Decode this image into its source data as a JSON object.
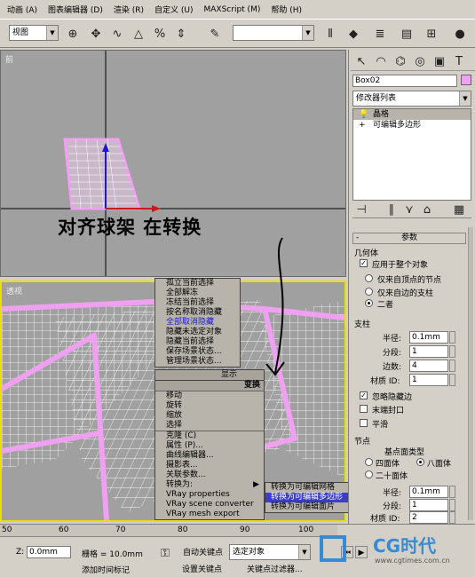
{
  "menu": [
    "动画 (A)",
    "图表编辑器 (D)",
    "渲染 (R)",
    "自定义 (U)",
    "MAXScript (M)",
    "帮助 (H)"
  ],
  "toolbar": {
    "view_combo": "视图",
    "selection_set_combo": "",
    "select_combo": "选择"
  },
  "viewports": {
    "top_label": "前",
    "perspective_label": "透视"
  },
  "annotation": "对齐球架  在转换",
  "context_menu_left": {
    "top_items": [
      "孤立当前选择",
      "全部解冻",
      "冻结当前选择",
      "按名称取消隐藏",
      "全部取消隐藏",
      "隐藏未选定对象",
      "隐藏当前选择",
      "保存场景状态...",
      "管理场景状态..."
    ],
    "display_header": "显示",
    "transform_header": "变换",
    "transform_items": [
      "移动",
      "旋转",
      "缩放",
      "选择",
      "克隆 (C)",
      "属性 (P)...",
      "曲线编辑器...",
      "摄影表...",
      "关联参数...",
      "转换为:",
      "VRay properties",
      "VRay scene converter",
      "VRay mesh export"
    ]
  },
  "submenu": [
    "转换为可编辑网格",
    "转换为可编辑多边形",
    "转换为可编辑面片"
  ],
  "command_panel": {
    "object_name": "Box02",
    "modifier_list": "修改器列表",
    "stack": [
      "晶格",
      "可编辑多边形"
    ],
    "rollout_title": "参数",
    "geometry_group": "几何体",
    "apply_whole": "应用于整个对象",
    "radio_vertex_only": "仅来自顶点的节点",
    "radio_edge_only": "仅来自边的支柱",
    "radio_both": "二者",
    "struts_group": "支柱",
    "radius_label": "半径:",
    "radius_value": "0.1mm",
    "segments_label": "分段:",
    "segments_value": "1",
    "sides_label": "边数:",
    "sides_value": "4",
    "material_label": "材质 ID:",
    "material_value": "1",
    "ignore_hidden": "忽略隐藏边",
    "end_caps": "末端封口",
    "smooth1": "平滑",
    "joints_group": "节点",
    "base_type": "基点面类型",
    "tetra": "四面体",
    "octa": "八面体",
    "icosa": "二十面体",
    "j_radius_value": "0.1mm",
    "j_segments_value": "1",
    "j_material_value": "2",
    "smooth2": "平滑"
  },
  "status": {
    "ruler": [
      "50",
      "60",
      "70",
      "80",
      "90",
      "100"
    ],
    "z_label": "Z:",
    "z_value": "0.0mm",
    "grid_label": "栅格 = 10.0mm",
    "auto_key": "自动关键点",
    "selected_obj": "选定对象",
    "set_key": "设置关键点",
    "key_filters": "关键点过滤器...",
    "add_time_tag": "添加时间标记"
  },
  "watermark": {
    "logo": "CG时代",
    "url": "www.cgtimes.com.cn"
  },
  "colors": {
    "wire": "#f0a0f0",
    "selected": "#3c3ccc",
    "viewport_bg": "#a0a0a0",
    "active_border": "#e8e000"
  }
}
